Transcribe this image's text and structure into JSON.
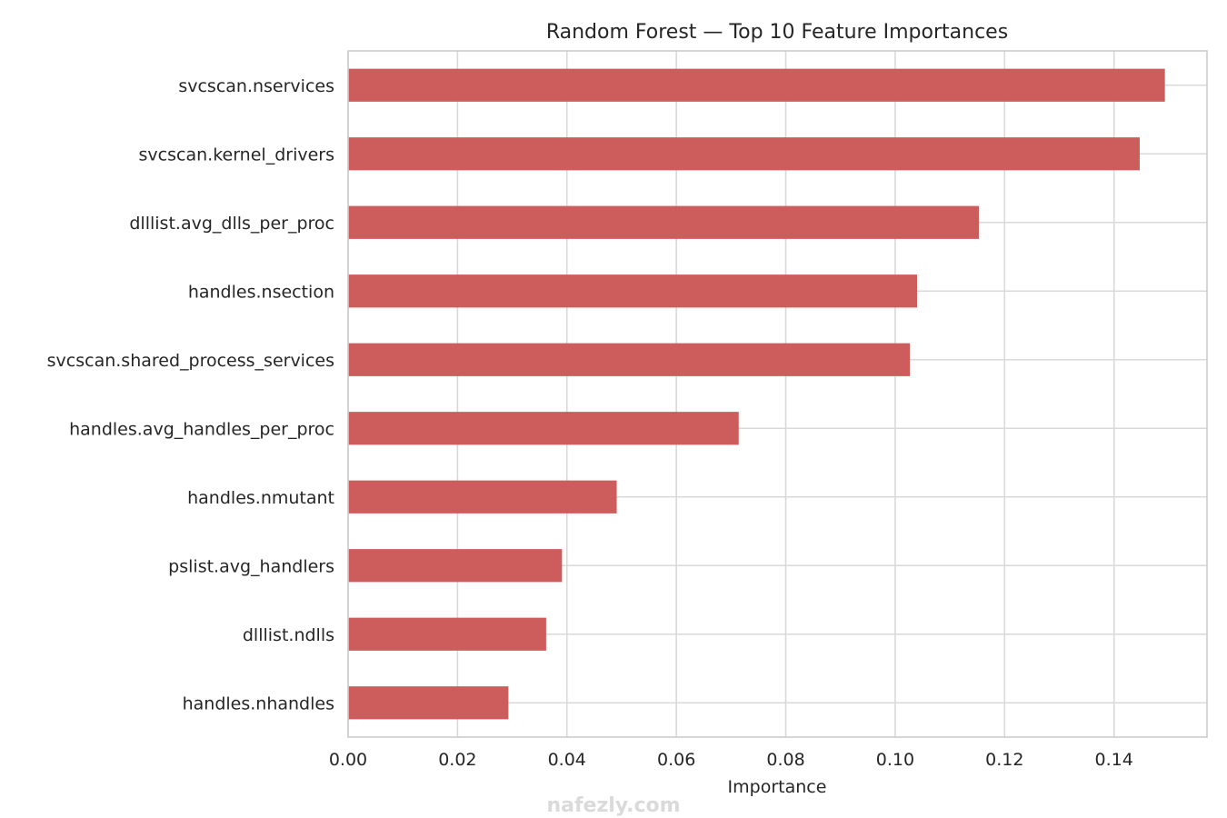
{
  "chart_data": {
    "type": "bar",
    "orientation": "horizontal",
    "title": "Random Forest — Top 10 Feature Importances",
    "xlabel": "Importance",
    "ylabel": "",
    "categories": [
      "svcscan.nservices",
      "svcscan.kernel_drivers",
      "dlllist.avg_dlls_per_proc",
      "handles.nsection",
      "svcscan.shared_process_services",
      "handles.avg_handles_per_proc",
      "handles.nmutant",
      "pslist.avg_handlers",
      "dlllist.ndlls",
      "handles.nhandles"
    ],
    "values": [
      0.1493,
      0.1447,
      0.1153,
      0.104,
      0.1027,
      0.0714,
      0.0491,
      0.0391,
      0.0362,
      0.0293
    ],
    "xlim": [
      0,
      0.157
    ],
    "xticks": [
      0.0,
      0.02,
      0.04,
      0.06,
      0.08,
      0.1,
      0.12,
      0.14
    ],
    "xtick_labels": [
      "0.00",
      "0.02",
      "0.04",
      "0.06",
      "0.08",
      "0.10",
      "0.12",
      "0.14"
    ],
    "grid": true,
    "bar_color": "#cd5c5c"
  },
  "watermark": {
    "text": "nafezly.com"
  }
}
